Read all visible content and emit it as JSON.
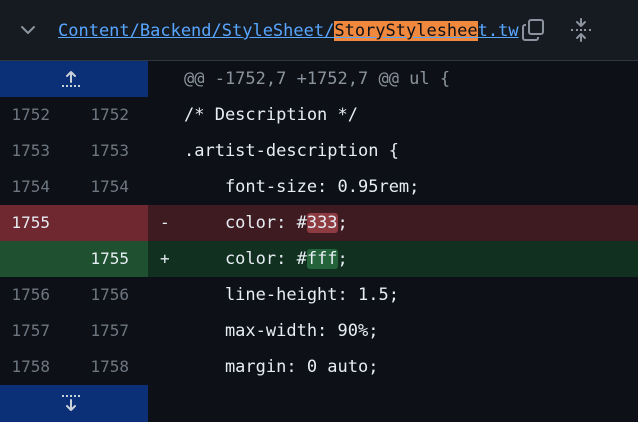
{
  "file": {
    "path_prefix": "Content/Backend/StyleSheet/",
    "path_highlight": "StoryStyleshee",
    "path_suffix": "t.tw"
  },
  "icons": {
    "collapse": "chevron-down-icon",
    "copy": "copy-icon",
    "expand": "expand-all-icon",
    "expand_up": "expand-up-icon",
    "expand_down": "expand-down-icon"
  },
  "hunk": {
    "header": "@@ -1752,7 +1752,7 @@ ul {"
  },
  "lines": [
    {
      "type": "context",
      "old": "1752",
      "new": "1752",
      "marker": "",
      "code": "/* Description */"
    },
    {
      "type": "context",
      "old": "1753",
      "new": "1753",
      "marker": "",
      "code": ".artist-description {"
    },
    {
      "type": "context",
      "old": "1754",
      "new": "1754",
      "marker": "",
      "code": "    font-size: 0.95rem;"
    },
    {
      "type": "del",
      "old": "1755",
      "new": "",
      "marker": "-",
      "code_pre": "    color: #",
      "code_tok": "333",
      "code_post": ";"
    },
    {
      "type": "add",
      "old": "",
      "new": "1755",
      "marker": "+",
      "code_pre": "    color: #",
      "code_tok": "fff",
      "code_post": ";"
    },
    {
      "type": "context",
      "old": "1756",
      "new": "1756",
      "marker": "",
      "code": "    line-height: 1.5;"
    },
    {
      "type": "context",
      "old": "1757",
      "new": "1757",
      "marker": "",
      "code": "    max-width: 90%;"
    },
    {
      "type": "context",
      "old": "1758",
      "new": "1758",
      "marker": "",
      "code": "    margin: 0 auto;"
    }
  ],
  "colors": {
    "deletion_bg": "#3e1b20",
    "addition_bg": "#12301f",
    "link": "#58a6ff",
    "highlight": "#f0883e"
  }
}
